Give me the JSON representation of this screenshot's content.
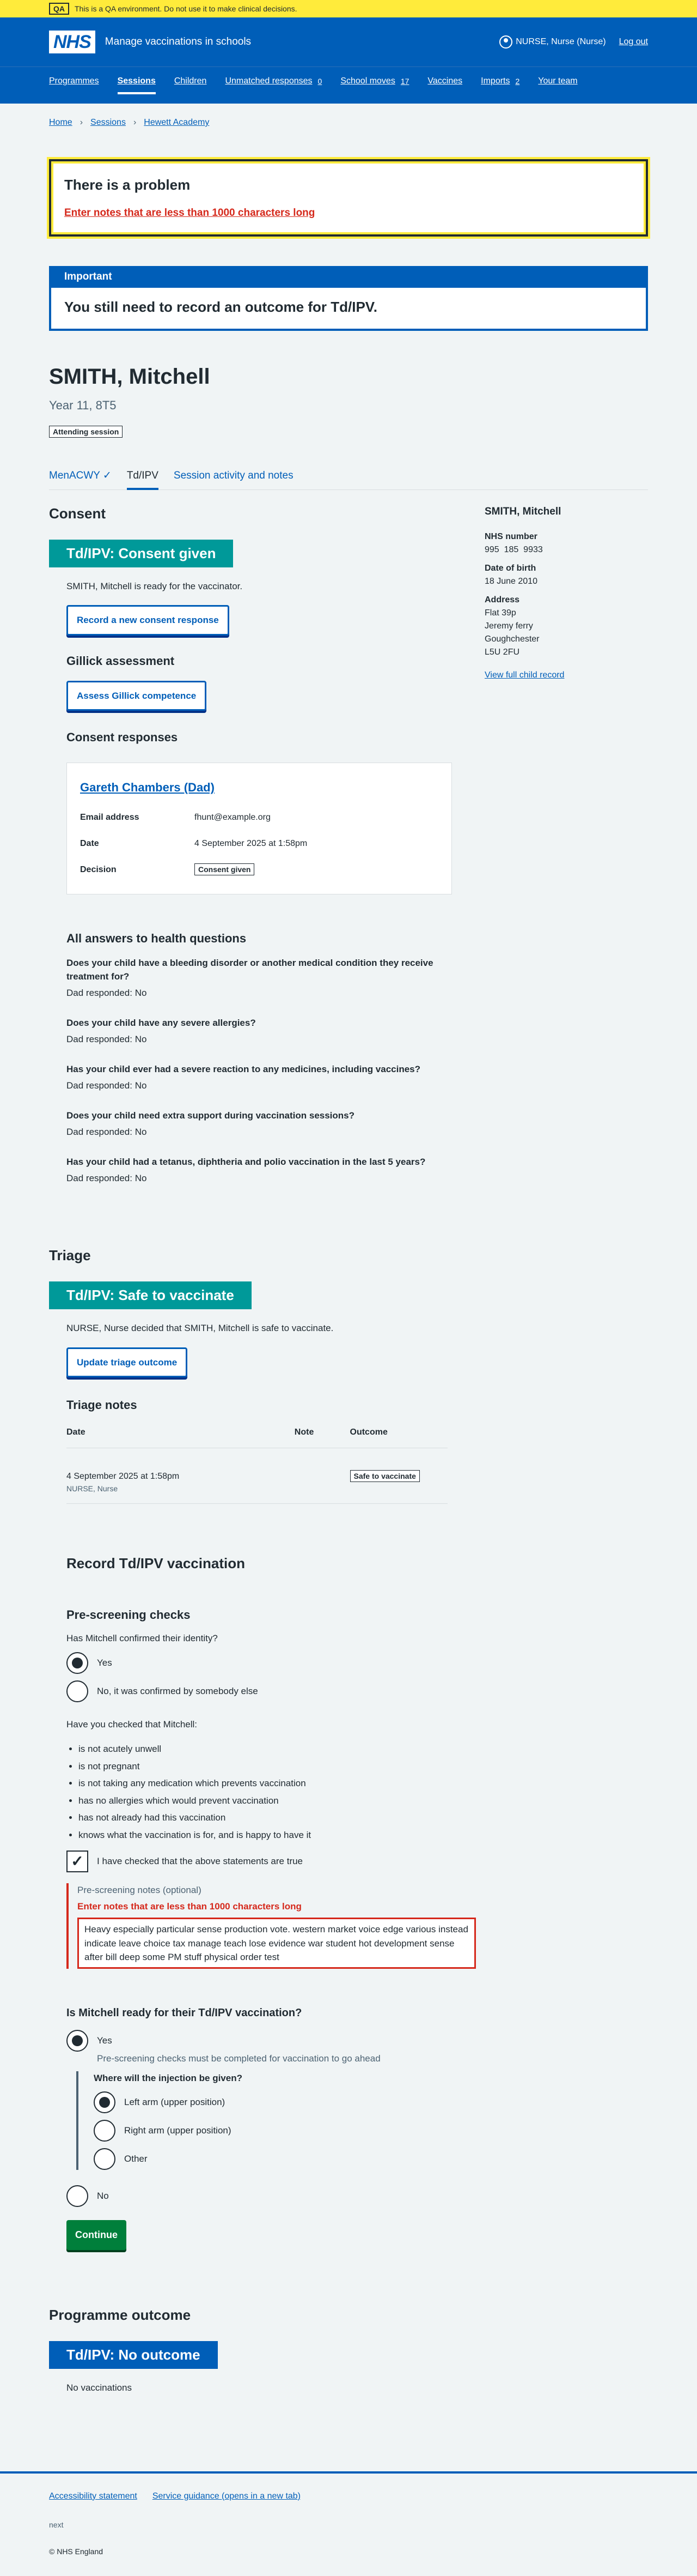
{
  "qa": {
    "tag": "QA",
    "text": "This is a QA environment. Do not use it to make clinical decisions."
  },
  "header": {
    "logo": "NHS",
    "service": "Manage vaccinations in schools",
    "user": "NURSE, Nurse (Nurse)",
    "logout": "Log out"
  },
  "nav": [
    {
      "label": "Programmes",
      "count": ""
    },
    {
      "label": "Sessions",
      "count": ""
    },
    {
      "label": "Children",
      "count": ""
    },
    {
      "label": "Unmatched responses",
      "count": "0"
    },
    {
      "label": "School moves",
      "count": "17"
    },
    {
      "label": "Vaccines",
      "count": ""
    },
    {
      "label": "Imports",
      "count": "2"
    },
    {
      "label": "Your team",
      "count": ""
    }
  ],
  "breadcrumb": [
    "Home",
    "Sessions",
    "Hewett Academy"
  ],
  "error_summary": {
    "title": "There is a problem",
    "link": "Enter notes that are less than 1000 characters long"
  },
  "important": {
    "label": "Important",
    "body": "You still need to record an outcome for Td/IPV."
  },
  "patient": {
    "name": "SMITH, Mitchell",
    "year": "Year 11, 8T5",
    "tag": "Attending session"
  },
  "tabs": [
    {
      "label": "MenACWY",
      "tick": "✓"
    },
    {
      "label": "Td/IPV",
      "tick": ""
    },
    {
      "label": "Session activity and notes",
      "tick": ""
    }
  ],
  "consent": {
    "heading": "Consent",
    "status": "Td/IPV: Consent given",
    "ready_text": "SMITH, Mitchell is ready for the vaccinator.",
    "record_button": "Record a new consent response",
    "gillick_heading": "Gillick assessment",
    "gillick_button": "Assess Gillick competence",
    "responses_heading": "Consent responses",
    "response": {
      "name": "Gareth Chambers (Dad)",
      "email_label": "Email address",
      "email": "fhunt@example.org",
      "date_label": "Date",
      "date": "4 September 2025 at 1:58pm",
      "decision_label": "Decision",
      "decision": "Consent given"
    },
    "health_heading": "All answers to health questions",
    "health": [
      {
        "q": "Does your child have a bleeding disorder or another medical condition they receive treatment for?",
        "a": "Dad responded: No"
      },
      {
        "q": "Does your child have any severe allergies?",
        "a": "Dad responded: No"
      },
      {
        "q": "Has your child ever had a severe reaction to any medicines, including vaccines?",
        "a": "Dad responded: No"
      },
      {
        "q": "Does your child need extra support during vaccination sessions?",
        "a": "Dad responded: No"
      },
      {
        "q": "Has your child had a tetanus, diphtheria and polio vaccination in the last 5 years?",
        "a": "Dad responded: No"
      }
    ]
  },
  "sidebar": {
    "name": "SMITH, Mitchell",
    "nhs_label": "NHS number",
    "nhs": "995  185  9933",
    "dob_label": "Date of birth",
    "dob": "18 June 2010",
    "address_label": "Address",
    "address": [
      "Flat 39p",
      "Jeremy ferry",
      "Goughchester",
      "L5U 2FU"
    ],
    "record_link": "View full child record"
  },
  "triage": {
    "heading": "Triage",
    "status": "Td/IPV: Safe to vaccinate",
    "text": "NURSE, Nurse decided that SMITH, Mitchell is safe to vaccinate.",
    "button": "Update triage outcome",
    "notes_heading": "Triage notes",
    "cols": [
      "Date",
      "Note",
      "Outcome"
    ],
    "row": {
      "date": "4 September 2025 at 1:58pm",
      "by": "NURSE, Nurse",
      "note": "",
      "outcome": "Safe to vaccinate"
    }
  },
  "record": {
    "heading": "Record Td/IPV vaccination",
    "prescreen_heading": "Pre-screening checks",
    "identity_q": "Has Mitchell confirmed their identity?",
    "identity_yes": "Yes",
    "identity_other": "No, it was confirmed by somebody else",
    "checked_q": "Have you checked that Mitchell:",
    "checks": [
      "is not acutely unwell",
      "is not pregnant",
      "is not taking any medication which prevents vaccination",
      "has no allergies which would prevent vaccination",
      "has not already had this vaccination",
      "knows what the vaccination is for, and is happy to have it"
    ],
    "confirm_label": "I have checked that the above statements are true",
    "notes_label": "Pre-screening notes (optional)",
    "notes_error": "Enter notes that are less than 1000 characters long",
    "notes_value": "Heavy especially particular sense production vote. western market voice edge various instead indicate leave choice tax manage teach lose evidence war student hot development sense after bill deep some PM stuff physical order test",
    "ready_q": "Is Mitchell ready for their Td/IPV vaccination?",
    "ready_yes": "Yes",
    "ready_hint": "Pre-screening checks must be completed for vaccination to go ahead",
    "site_q": "Where will the injection be given?",
    "sites": [
      "Left arm (upper position)",
      "Right arm (upper position)",
      "Other"
    ],
    "ready_no": "No",
    "continue": "Continue"
  },
  "outcome": {
    "heading": "Programme outcome",
    "status": "Td/IPV: No outcome",
    "text": "No vaccinations"
  },
  "footer": {
    "links": [
      "Accessibility statement",
      "Service guidance (opens in a new tab)"
    ],
    "meta": "next",
    "copyright": "© NHS England"
  }
}
